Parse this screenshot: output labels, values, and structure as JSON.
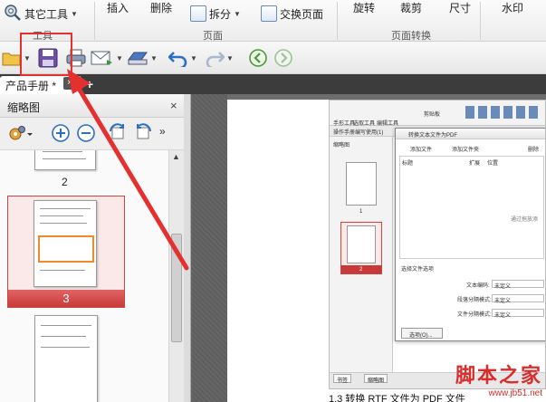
{
  "ribbon": {
    "more_tools": "其它工具",
    "more_tools_sub": "工具",
    "insert": "插入",
    "delete": "删除",
    "split": "拆分",
    "swap_pages": "交换页面",
    "group_page": "页面",
    "rotate": "旋转",
    "crop": "裁剪",
    "size": "尺寸",
    "group_page_transform": "页面转换",
    "watermark": "水印"
  },
  "tabs": {
    "active_doc": "产品手册 *",
    "close_glyph": "×",
    "add_glyph": "+"
  },
  "thumbnail_panel": {
    "title": "缩略图",
    "close_glyph": "×",
    "thumbnails": [
      {
        "label": "2"
      },
      {
        "label": "3",
        "selected": true
      }
    ]
  },
  "embedded": {
    "toolbar_labels": [
      "手形工具",
      "选取工具",
      "编辑工具",
      "剪贴板"
    ],
    "side_title": "操作手册编写使用(1)",
    "thumb_title": "缩略图",
    "thumb_labels": [
      "1",
      "2"
    ],
    "dialog_title": "转换文本文件为PDF",
    "add_file": "添加文件",
    "add_folder": "添加文件夹",
    "delete": "删除",
    "col_title": "标题",
    "col_ext": "扩展",
    "col_location": "位置",
    "drop_hint": "通过拖放添",
    "options_section": "选择文件选项",
    "text_encoding_label": "文本编码:",
    "paragraph_mode_label": "段落分隔模式:",
    "file_split_label": "文件分隔模式:",
    "undefined_value": "未定义",
    "options_button": "选项(O)...",
    "bottom_tab_bookmark": "书签",
    "bottom_tab_thumbnail": "缩略图"
  },
  "page_caption": "1.3 转换 RTF 文件为 PDF 文件",
  "watermark": {
    "title": "脚本之家",
    "url": "www.jb51.net"
  },
  "colors": {
    "highlight": "#e53030",
    "selected_bar": "#c83a3a",
    "tabbar": "#3c3c3c"
  }
}
